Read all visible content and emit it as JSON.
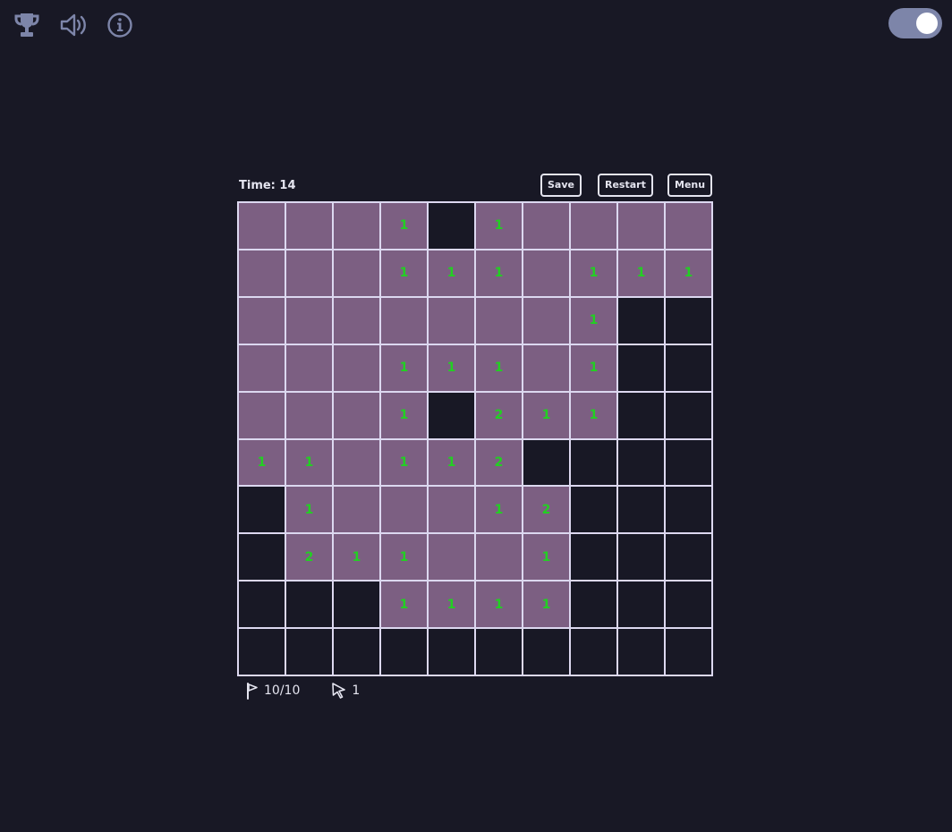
{
  "toolbar": {
    "icons": [
      "trophy-icon",
      "speaker-icon",
      "info-icon"
    ],
    "theme_toggle_on": true
  },
  "game": {
    "time_text": "Time: 14",
    "save_label": "Save",
    "restart_label": "Restart",
    "menu_label": "Menu",
    "flags_text": "10/10",
    "clicks_text": "1"
  },
  "colors": {
    "background": "#181825",
    "revealed": "#7c5f82",
    "number": "#22d022",
    "border": "#dcd8f0"
  },
  "board": [
    [
      "R",
      "R",
      "R",
      "1",
      "H",
      "1",
      "R",
      "R",
      "R",
      "R"
    ],
    [
      "R",
      "R",
      "R",
      "1",
      "1",
      "1",
      "R",
      "1",
      "1",
      "1"
    ],
    [
      "R",
      "R",
      "R",
      "R",
      "R",
      "R",
      "R",
      "1",
      "H",
      "H"
    ],
    [
      "R",
      "R",
      "R",
      "1",
      "1",
      "1",
      "R",
      "1",
      "H",
      "H"
    ],
    [
      "R",
      "R",
      "R",
      "1",
      "H",
      "2",
      "1",
      "1",
      "H",
      "H"
    ],
    [
      "1",
      "1",
      "R",
      "1",
      "1",
      "2",
      "H",
      "H",
      "H",
      "H"
    ],
    [
      "H",
      "1",
      "R",
      "R",
      "R",
      "1",
      "2",
      "H",
      "H",
      "H"
    ],
    [
      "H",
      "2",
      "1",
      "1",
      "R",
      "R",
      "1",
      "H",
      "H",
      "H"
    ],
    [
      "H",
      "H",
      "H",
      "1",
      "1",
      "1",
      "1",
      "H",
      "H",
      "H"
    ],
    [
      "H",
      "H",
      "H",
      "H",
      "H",
      "H",
      "H",
      "H",
      "H",
      "H"
    ]
  ]
}
